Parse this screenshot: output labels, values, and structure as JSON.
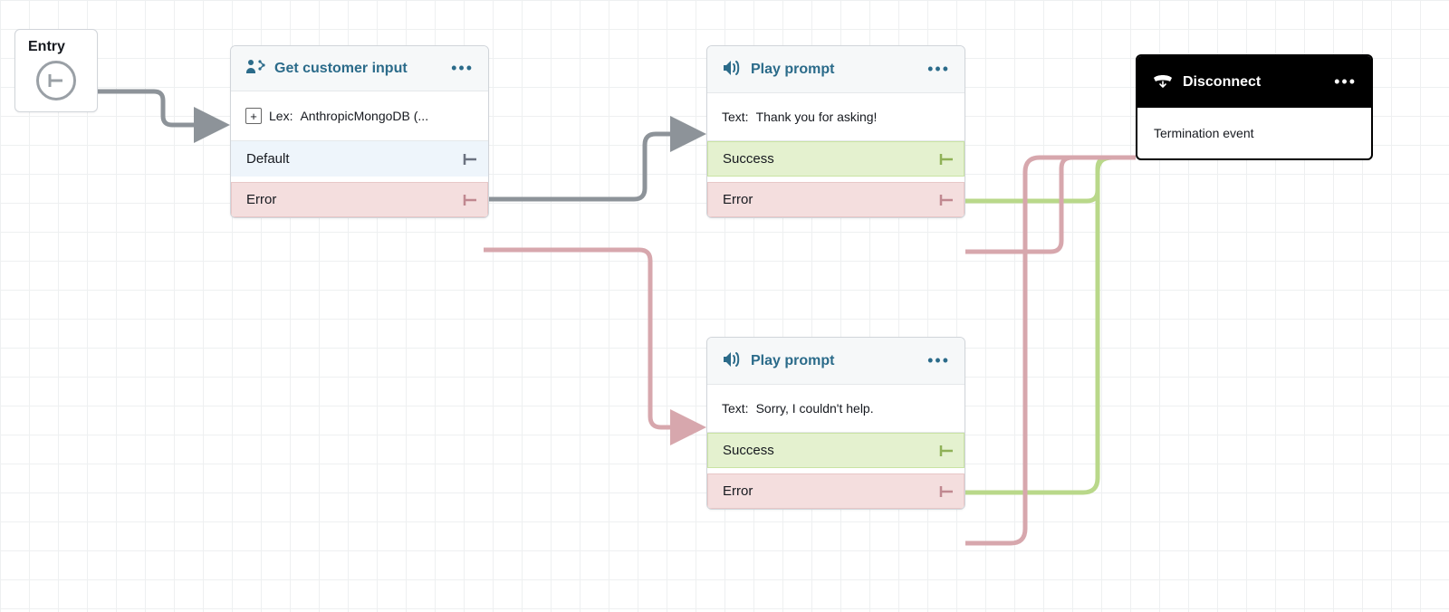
{
  "entry": {
    "label": "Entry"
  },
  "nodes": {
    "get_input": {
      "title": "Get customer input",
      "body_prefix": "Lex:",
      "body_value": "AnthropicMongoDB (...",
      "branches": [
        {
          "key": "default",
          "label": "Default"
        },
        {
          "key": "error",
          "label": "Error"
        }
      ]
    },
    "prompt_thanks": {
      "title": "Play prompt",
      "body_prefix": "Text:",
      "body_value": "Thank you for asking!",
      "branches": [
        {
          "key": "success",
          "label": "Success"
        },
        {
          "key": "error",
          "label": "Error"
        }
      ]
    },
    "prompt_sorry": {
      "title": "Play prompt",
      "body_prefix": "Text:",
      "body_value": "Sorry, I couldn't help.",
      "branches": [
        {
          "key": "success",
          "label": "Success"
        },
        {
          "key": "error",
          "label": "Error"
        }
      ]
    },
    "disconnect": {
      "title": "Disconnect",
      "body_value": "Termination event"
    }
  },
  "colors": {
    "edge_gray": "#8d9399",
    "edge_pink": "#d7a7ad",
    "edge_green": "#b9d88a",
    "brand_blue": "#2b6b8a"
  }
}
